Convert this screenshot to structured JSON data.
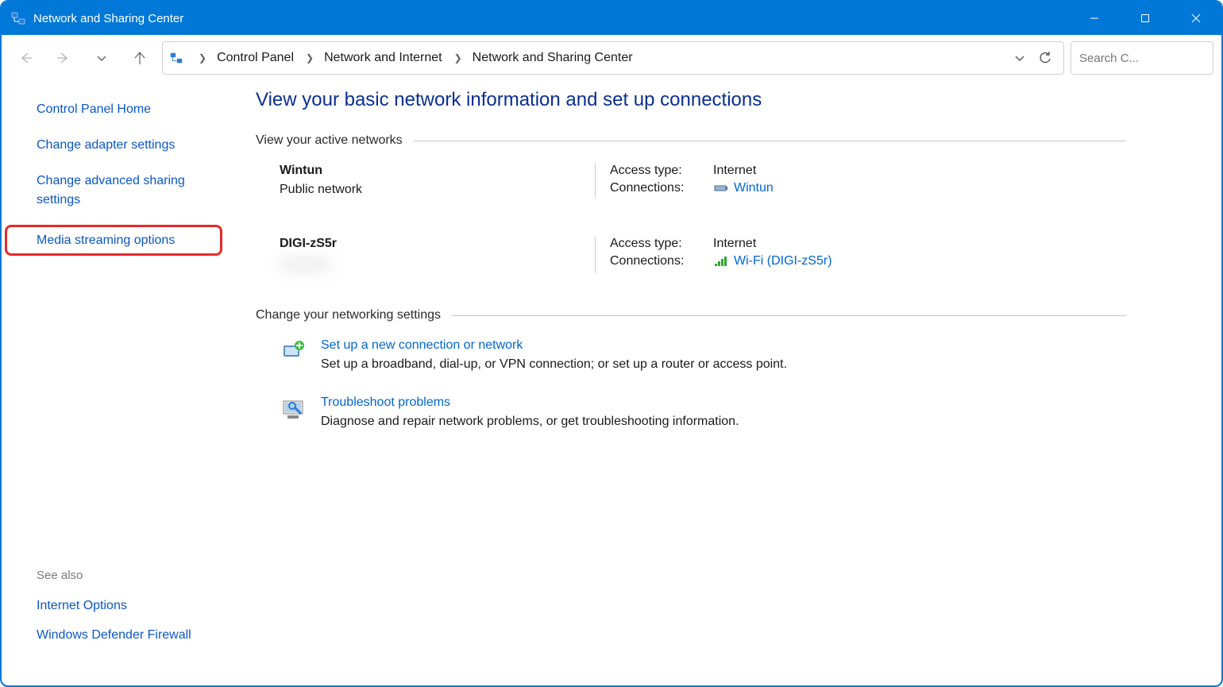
{
  "window": {
    "title": "Network and Sharing Center"
  },
  "breadcrumb": {
    "items": [
      "Control Panel",
      "Network and Internet",
      "Network and Sharing Center"
    ]
  },
  "search": {
    "placeholder": "Search C..."
  },
  "sidebar": {
    "links": [
      "Control Panel Home",
      "Change adapter settings",
      "Change advanced sharing settings",
      "Media streaming options"
    ],
    "see_also_label": "See also",
    "see_also": [
      "Internet Options",
      "Windows Defender Firewall"
    ]
  },
  "content": {
    "heading": "View your basic network information and set up connections",
    "active_section": "View your active networks",
    "access_type_label": "Access type:",
    "connections_label": "Connections:",
    "networks": [
      {
        "name": "Wintun",
        "profile": "Public network",
        "access_type": "Internet",
        "connection_link": "Wintun",
        "icon": "adapter"
      },
      {
        "name": "DIGI-zS5r",
        "profile": "",
        "profile_blurred": true,
        "access_type": "Internet",
        "connection_link": "Wi-Fi (DIGI-zS5r)",
        "icon": "wifi"
      }
    ],
    "change_section": "Change your networking settings",
    "settings": [
      {
        "title": "Set up a new connection or network",
        "desc": "Set up a broadband, dial-up, or VPN connection; or set up a router or access point.",
        "icon": "new-conn"
      },
      {
        "title": "Troubleshoot problems",
        "desc": "Diagnose and repair network problems, or get troubleshooting information.",
        "icon": "troubleshoot"
      }
    ]
  }
}
